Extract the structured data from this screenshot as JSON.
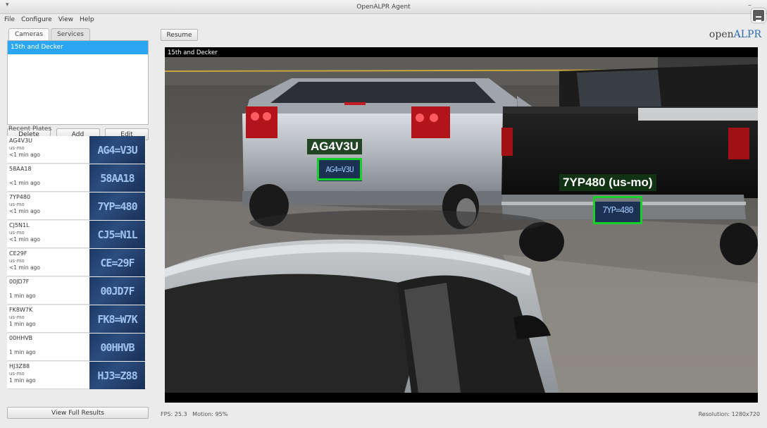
{
  "window": {
    "title": "OpenALPR Agent",
    "menu_glyph": "▾",
    "minimize_glyph": "–"
  },
  "menubar": [
    "File",
    "Configure",
    "View",
    "Help"
  ],
  "left": {
    "tabs": [
      "Cameras",
      "Services"
    ],
    "cameras": [
      "15th and Decker"
    ],
    "buttons": {
      "delete": "Delete",
      "add": "Add",
      "edit": "Edit"
    },
    "recent_label": "Recent Plates",
    "plates": [
      {
        "plate": "AG4V3U",
        "region": "us-mo",
        "time": "<1 min ago",
        "thumb": "AG4=V3U"
      },
      {
        "plate": "58AA18",
        "region": "",
        "time": "<1 min ago",
        "thumb": "58AA18"
      },
      {
        "plate": "7YP480",
        "region": "us-mo",
        "time": "<1 min ago",
        "thumb": "7YP=480"
      },
      {
        "plate": "CJ5N1L",
        "region": "us-mo",
        "time": "<1 min ago",
        "thumb": "CJ5=N1L"
      },
      {
        "plate": "CE29F",
        "region": "us-mo",
        "time": "<1 min ago",
        "thumb": "CE=29F"
      },
      {
        "plate": "00JD7F",
        "region": "",
        "time": "1 min ago",
        "thumb": "00JD7F"
      },
      {
        "plate": "FK8W7K",
        "region": "us-mo",
        "time": "1 min ago",
        "thumb": "FK8=W7K"
      },
      {
        "plate": "00HHVB",
        "region": "",
        "time": "1 min ago",
        "thumb": "00HHVB"
      },
      {
        "plate": "HJ3Z88",
        "region": "us-mo",
        "time": "1 min ago",
        "thumb": "HJ3=Z88"
      }
    ],
    "view_full": "View Full Results"
  },
  "main": {
    "resume": "Resume",
    "logo_o": "o",
    "logo_pen": "pen",
    "logo_alpr": "ALPR",
    "camera_label": "15th and Decker",
    "detections": [
      {
        "label": "AG4V3U",
        "plate_text": "AG4=V3U"
      },
      {
        "label": "7YP480 (us-mo)",
        "plate_text": "7YP=480"
      }
    ],
    "fps": "FPS: 25.3   Motion: 95%",
    "resolution": "Resolution: 1280x720"
  },
  "colors": {
    "selection": "#2aa7f0",
    "detection_box": "#17d12a",
    "logo_accent": "#2b6cb3"
  }
}
